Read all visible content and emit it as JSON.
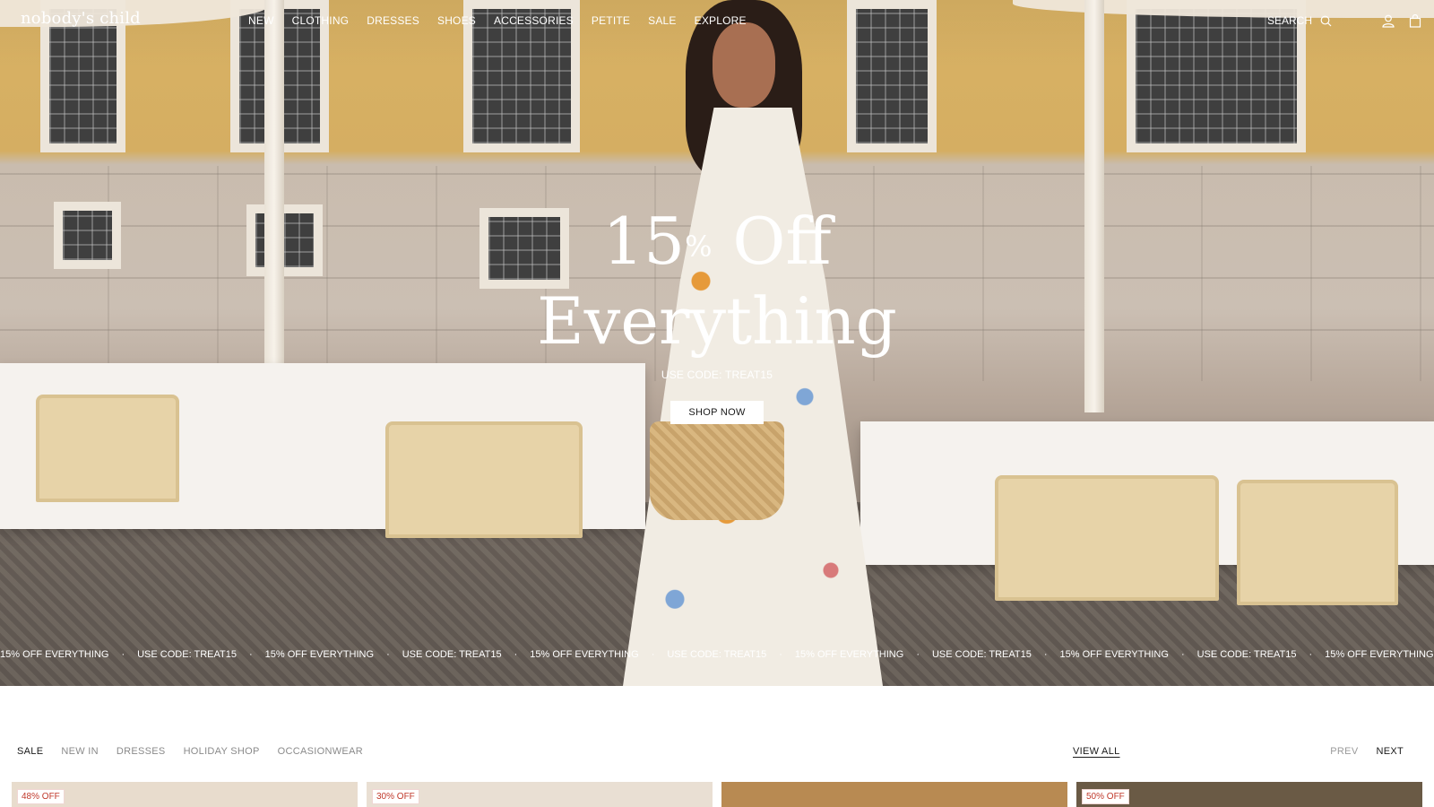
{
  "header": {
    "logo": "nobody's child",
    "nav": [
      "NEW",
      "CLOTHING",
      "DRESSES",
      "SHOES",
      "ACCESSORIES",
      "PETITE",
      "SALE",
      "EXPLORE"
    ],
    "search_label": "SEARCH",
    "icons": [
      "search-icon",
      "account-icon",
      "bag-icon"
    ]
  },
  "hero": {
    "headline_number": "15",
    "headline_percent": "%",
    "headline_off": " Off",
    "headline_line2": "Everything",
    "code_text": "USE CODE: TREAT15",
    "cta_label": "SHOP NOW"
  },
  "marquee": {
    "items": [
      "15% OFF EVERYTHING",
      "USE CODE: TREAT15",
      "15% OFF EVERYTHING",
      "USE CODE: TREAT15",
      "15% OFF EVERYTHING",
      "USE CODE: TREAT15",
      "15% OFF EVERYTHING",
      "USE CODE: TREAT15",
      "15% OFF EVERYTHING",
      "USE CODE: TREAT15",
      "15% OFF EVERYTHING",
      "USE CODE: TREAT15"
    ],
    "separator": "·"
  },
  "product_tabs": {
    "tabs": [
      "SALE",
      "NEW IN",
      "DRESSES",
      "HOLIDAY SHOP",
      "OCCASIONWEAR"
    ],
    "active_index": 0,
    "view_all": "VIEW ALL",
    "prev": "PREV",
    "next": "NEXT"
  },
  "product_cards": [
    {
      "badge": "48% OFF",
      "bg": "#e8dccd"
    },
    {
      "badge": "30% OFF",
      "bg": "#e9dfd3"
    },
    {
      "badge": "",
      "bg": "#b88a52"
    },
    {
      "badge": "50% OFF",
      "bg": "#6a5a45"
    }
  ],
  "colors": {
    "sale_badge_text": "#c0392b",
    "text_dark": "#1a1a1a",
    "text_muted": "#8a8a8a"
  }
}
